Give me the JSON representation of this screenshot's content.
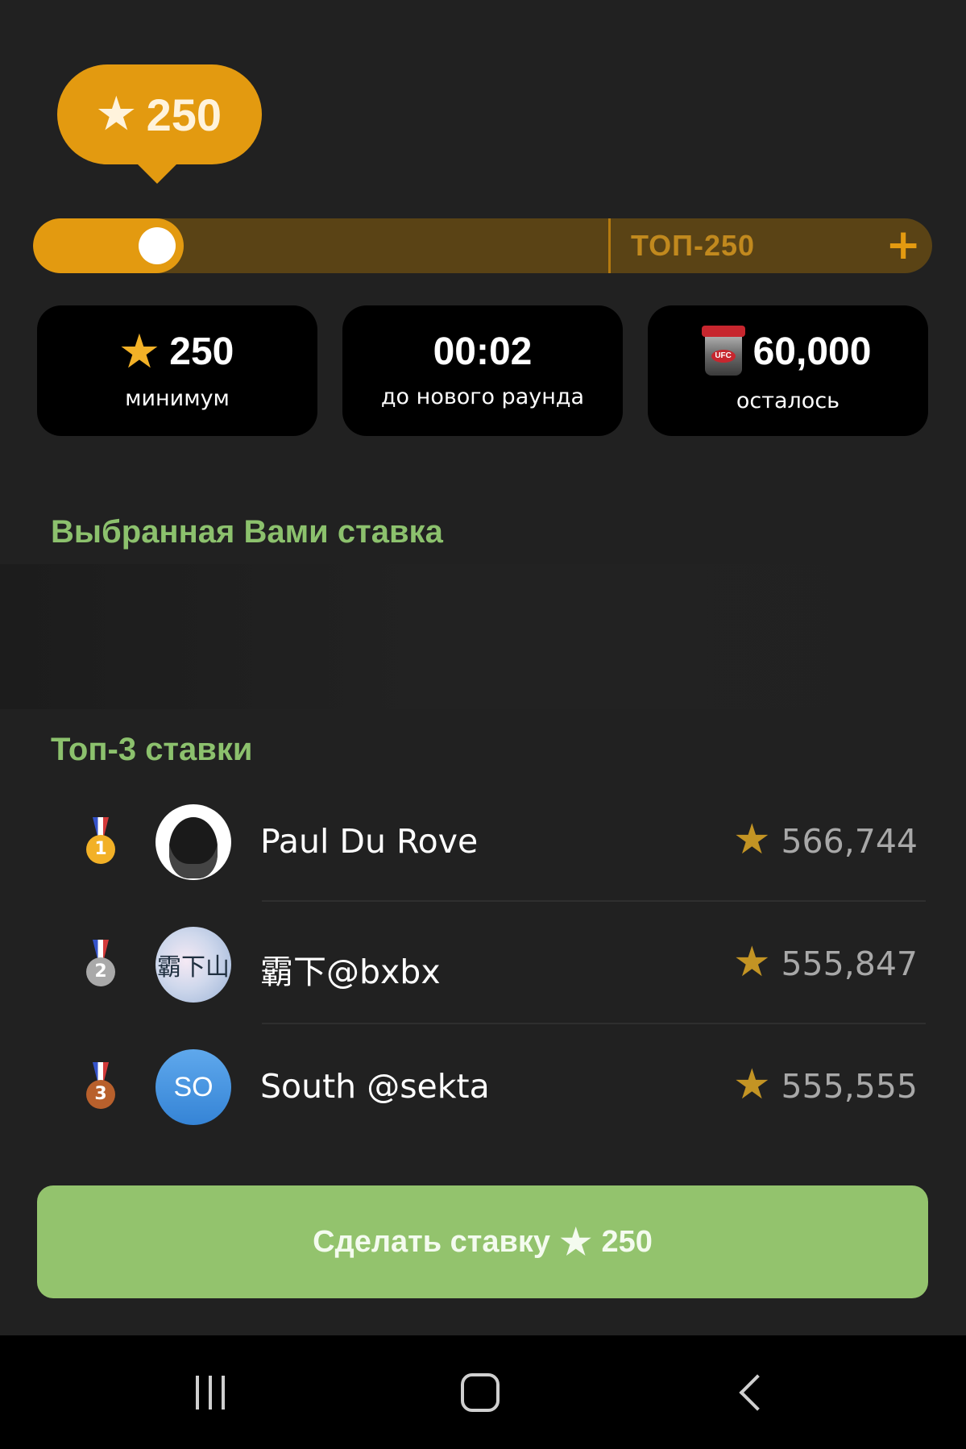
{
  "bid_bubble": {
    "star_icon": "star-icon",
    "amount": "250"
  },
  "slider": {
    "fill_fraction": 0.168,
    "tier_label": "ТОП-250",
    "plus_symbol": "+"
  },
  "stats": {
    "minimum": {
      "value": "250",
      "caption": "минимум"
    },
    "timer": {
      "value": "00:02",
      "caption": "до нового раунда"
    },
    "remaining": {
      "value": "60,000",
      "caption": "осталось"
    }
  },
  "sections": {
    "selected_bet": "Выбранная Вами ставка",
    "top3": "Топ-3 ставки"
  },
  "leaderboard": [
    {
      "rank": "1",
      "name": "Paul Du Rove",
      "amount": "566,744"
    },
    {
      "rank": "2",
      "name": "霸下@bxbx",
      "amount": "555,847",
      "avatar_text": "霸下山"
    },
    {
      "rank": "3",
      "name": "South @sekta",
      "amount": "555,555",
      "avatar_text": "SO"
    }
  ],
  "bet_button": {
    "label": "Сделать ставку",
    "amount": "250"
  },
  "colors": {
    "accent": "#e39a10",
    "green": "#93c36d",
    "section_title": "#8cc16d",
    "background": "#212121",
    "gold": "#f2b127",
    "silver": "#a9a9a9",
    "bronze": "#b8602c"
  }
}
